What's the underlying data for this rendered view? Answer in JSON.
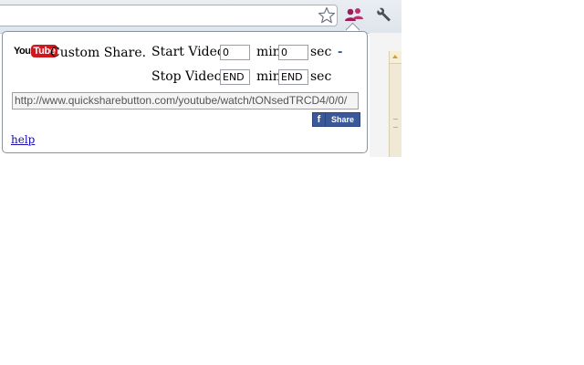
{
  "toolbar": {
    "star_icon": "star-icon",
    "extension_icon": "people-icon",
    "wrench_icon": "wrench-icon"
  },
  "popup": {
    "logo": {
      "you": "You",
      "tube": "Tube",
      "brand_color": "#cc181e"
    },
    "title": "Custom Share.",
    "start_label": "Start Video:",
    "start_min_value": "0",
    "min_label": "min",
    "start_sec_value": "0",
    "sec_label": "sec",
    "remove_link": "-",
    "stop_label": "Stop Video:",
    "stop_min_value": "END",
    "stop_sec_value": "END",
    "url_value": "http://www.quicksharebutton.com/youtube/watch/tONsedTRCD4/0/0/",
    "facebook": {
      "icon": "f",
      "label": "Share",
      "color": "#3b5998"
    },
    "help_link": "help"
  }
}
